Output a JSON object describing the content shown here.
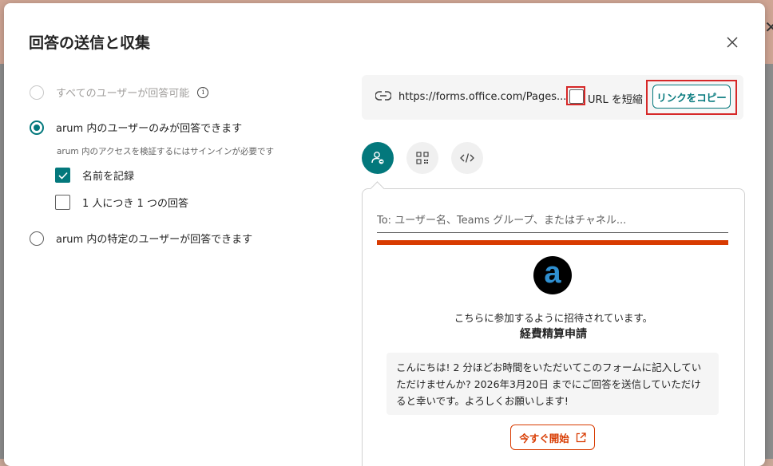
{
  "dialog": {
    "title": "回答の送信と収集",
    "close_icon": "close-icon"
  },
  "options": {
    "everyone_label": "すべてのユーザーが回答可能",
    "org_only_label": "arum 内のユーザーのみが回答できます",
    "org_only_hint": "arum 内のアクセスを検証するにはサインインが必要です",
    "record_name_label": "名前を記録",
    "one_response_label": "1 人につき 1 つの回答",
    "specific_people_label": "arum 内の特定のユーザーが回答できます",
    "info_glyph": "i",
    "selected": "org_only",
    "record_name_checked": true,
    "one_response_checked": false
  },
  "link": {
    "url": "https://forms.office.com/Pages...",
    "shorten_label": "URL を短縮",
    "shorten_checked": false,
    "copy_label": "リンクをコピー"
  },
  "share": {
    "tabs": [
      "person-share-icon",
      "qr-code-icon",
      "embed-code-icon"
    ],
    "active": "person-share-icon"
  },
  "preview": {
    "to_placeholder": "To: ユーザー名、Teams グループ、またはチャネル...",
    "avatar_letter": "a",
    "invite_text": "こちらに参加するように招待されています。",
    "form_name": "経費精算申請",
    "message": "こんにちは! 2 分ほどお時間をいただいてこのフォームに記入していただけませんか? 2026年3月20日 までにご回答を送信していただけると幸いです。よろしくお願いします!",
    "start_label": "今すぐ開始"
  },
  "colors": {
    "accent": "#03787c",
    "banner": "#d83b01",
    "highlight": "#d62828"
  }
}
